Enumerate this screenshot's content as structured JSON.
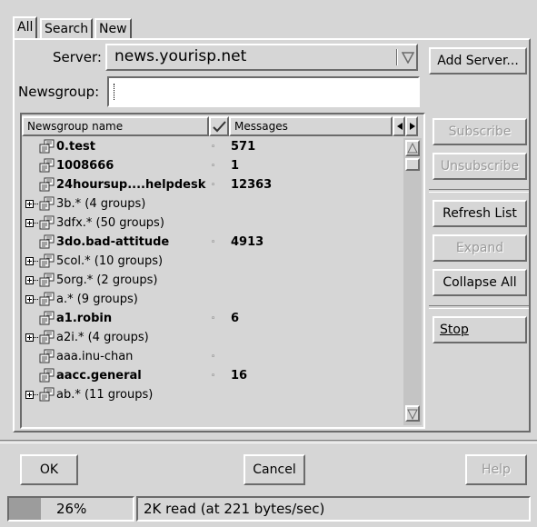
{
  "tabs": [
    "All",
    "Search",
    "New"
  ],
  "server": {
    "label": "Server:",
    "value": "news.yourisp.net"
  },
  "newsgroup_field": {
    "label": "Newsgroup:",
    "value": ""
  },
  "buttons": {
    "add_server": "Add Server...",
    "subscribe": "Subscribe",
    "unsubscribe": "Unsubscribe",
    "refresh_list": "Refresh List",
    "expand": "Expand",
    "collapse_all": "Collapse All",
    "stop": "Stop",
    "ok": "OK",
    "cancel": "Cancel",
    "help": "Help"
  },
  "table": {
    "columns": [
      "Newsgroup name",
      "Messages"
    ],
    "rows": [
      {
        "name": "0.test",
        "bold": true,
        "expandable": false,
        "mark": "◦",
        "count": "571"
      },
      {
        "name": "1008666",
        "bold": true,
        "expandable": false,
        "mark": "◦",
        "count": "1"
      },
      {
        "name": "24hoursup....helpdesk",
        "bold": true,
        "expandable": false,
        "mark": "◦",
        "count": "12363"
      },
      {
        "name": "3b.* (4 groups)",
        "bold": false,
        "expandable": true,
        "mark": "",
        "count": ""
      },
      {
        "name": "3dfx.* (50 groups)",
        "bold": false,
        "expandable": true,
        "mark": "",
        "count": ""
      },
      {
        "name": "3do.bad-attitude",
        "bold": true,
        "expandable": false,
        "mark": "◦",
        "count": "4913"
      },
      {
        "name": "5col.* (10 groups)",
        "bold": false,
        "expandable": true,
        "mark": "",
        "count": ""
      },
      {
        "name": "5org.* (2 groups)",
        "bold": false,
        "expandable": true,
        "mark": "",
        "count": ""
      },
      {
        "name": "a.* (9 groups)",
        "bold": false,
        "expandable": true,
        "mark": "",
        "count": ""
      },
      {
        "name": "a1.robin",
        "bold": true,
        "expandable": false,
        "mark": "◦",
        "count": "6"
      },
      {
        "name": "a2i.* (4 groups)",
        "bold": false,
        "expandable": true,
        "mark": "",
        "count": ""
      },
      {
        "name": "aaa.inu-chan",
        "bold": false,
        "expandable": false,
        "mark": "◦",
        "count": ""
      },
      {
        "name": "aacc.general",
        "bold": true,
        "expandable": false,
        "mark": "◦",
        "count": "16"
      },
      {
        "name": "ab.* (11 groups)",
        "bold": false,
        "expandable": true,
        "mark": "",
        "count": ""
      }
    ]
  },
  "status": {
    "progress_text": "26%",
    "progress_fraction": 0.26,
    "message": "2K read (at 221 bytes/sec)"
  },
  "colors": {
    "window_bg": "#d6d6d6",
    "field_bg": "#ffffff",
    "progress_fill": "#9c9c9c"
  }
}
